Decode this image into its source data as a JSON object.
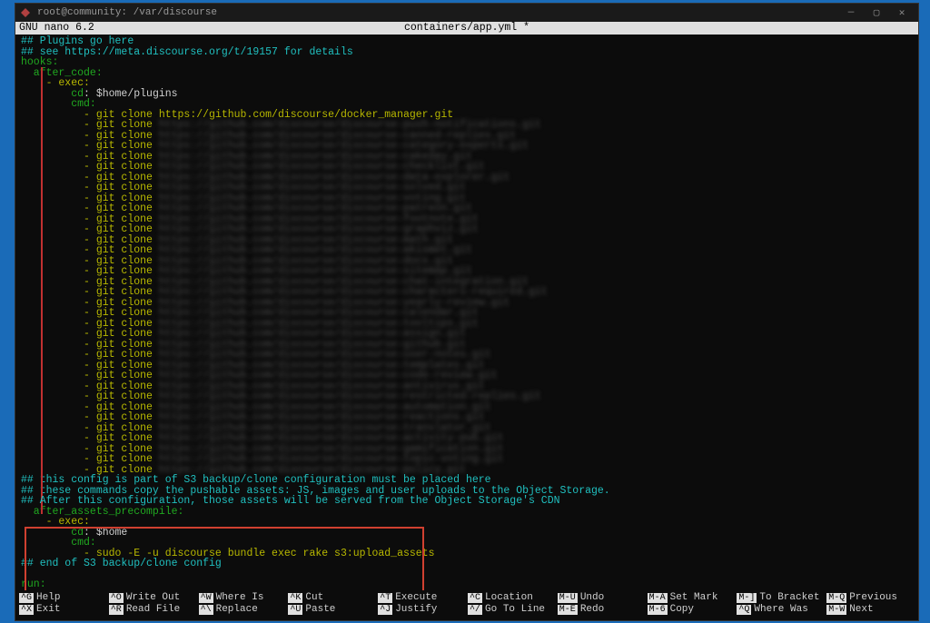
{
  "window": {
    "title": "root@community: /var/discourse"
  },
  "editor": {
    "name": "GNU nano 6.2",
    "filename": "containers/app.yml *"
  },
  "content": {
    "comment_plugins": "## Plugins go here",
    "comment_see": "## see https://meta.discourse.org/t/19157 for details",
    "hooks": "hooks:",
    "after_code": "  after_code:",
    "exec1": "    - exec:",
    "cd1": "        cd: $home/plugins",
    "cmd1": "        cmd:",
    "clone_prefix": "          - git clone ",
    "first_clone_url": "https://github.com/discourse/docker_manager.git",
    "blurred_suffixes": [
      "https://github.com/discourse/discourse-push-notifications.git",
      "https://github.com/discourse/discourse-canned-replies.git",
      "https://github.com/discourse/discourse-category-experts.git",
      "https://github.com/discourse/discourse-cakeday.git",
      "https://github.com/discourse/discourse-checklist.git",
      "https://github.com/discourse/discourse-data-explorer.git",
      "https://github.com/discourse/discourse-solved.git",
      "https://github.com/discourse/discourse-voting.git",
      "https://github.com/discourse/discourse-patreon.git",
      "https://github.com/discourse/discourse-footnote.git",
      "https://github.com/discourse/discourse-graphviz.git",
      "https://github.com/discourse/discourse-math.git",
      "https://github.com/discourse/discourse-akismet.git",
      "https://github.com/discourse/discourse-docs.git",
      "https://github.com/discourse/discourse-sitemap.git",
      "https://github.com/discourse/discourse-chat-integration.git",
      "https://github.com/discourse/discourse-characters-required.git",
      "https://github.com/discourse/discourse-yearly-review.git",
      "https://github.com/discourse/discourse-calendar.git",
      "https://github.com/discourse/discourse-tooltips.git",
      "https://github.com/discourse/discourse-assign.git",
      "https://github.com/discourse/discourse-github.git",
      "https://github.com/discourse/discourse-user-notes.git",
      "https://github.com/discourse/discourse-templates.git",
      "https://github.com/discourse/discourse-code-review.git",
      "https://github.com/discourse/discourse-antivirus.git",
      "https://github.com/discourse/discourse-restricted-replies.git",
      "https://github.com/discourse/discourse-automation.git",
      "https://github.com/discourse/discourse-reactions.git",
      "https://github.com/discourse/discourse-translator.git",
      "https://github.com/discourse/discourse-activity-pub.git",
      "https://github.com/discourse/discourse-gamification.git",
      "https://github.com/discourse/discourse-topic-voting.git",
      "https://github.com/discourse/discourse-policy.git"
    ],
    "comment_s3_1": "## this config is part of S3 backup/clone configuration must be placed here",
    "comment_s3_2": "## these commands copy the pushable assets: JS, images and user uploads to the Object Storage.",
    "comment_s3_3": "## After this configuration, those assets will be served from the Object Storage's CDN",
    "after_assets": "  after_assets_precompile:",
    "exec2": "    - exec:",
    "cd2": "        cd: $home",
    "cmd2": "        cmd:",
    "sudo_line": "          - sudo -E -u discourse bundle exec rake s3:upload_assets",
    "comment_end": "## end of S3 backup/clone config",
    "run": "run:"
  },
  "footer": [
    {
      "k": "^G",
      "l": "Help"
    },
    {
      "k": "^O",
      "l": "Write Out"
    },
    {
      "k": "^W",
      "l": "Where Is"
    },
    {
      "k": "^K",
      "l": "Cut"
    },
    {
      "k": "^T",
      "l": "Execute"
    },
    {
      "k": "^C",
      "l": "Location"
    },
    {
      "k": "M-U",
      "l": "Undo"
    },
    {
      "k": "M-A",
      "l": "Set Mark"
    },
    {
      "k": "M-]",
      "l": "To Bracket"
    },
    {
      "k": "M-Q",
      "l": "Previous"
    },
    {
      "k": "^X",
      "l": "Exit"
    },
    {
      "k": "^R",
      "l": "Read File"
    },
    {
      "k": "^\\",
      "l": "Replace"
    },
    {
      "k": "^U",
      "l": "Paste"
    },
    {
      "k": "^J",
      "l": "Justify"
    },
    {
      "k": "^/",
      "l": "Go To Line"
    },
    {
      "k": "M-E",
      "l": "Redo"
    },
    {
      "k": "M-6",
      "l": "Copy"
    },
    {
      "k": "^Q",
      "l": "Where Was"
    },
    {
      "k": "M-W",
      "l": "Next"
    }
  ]
}
